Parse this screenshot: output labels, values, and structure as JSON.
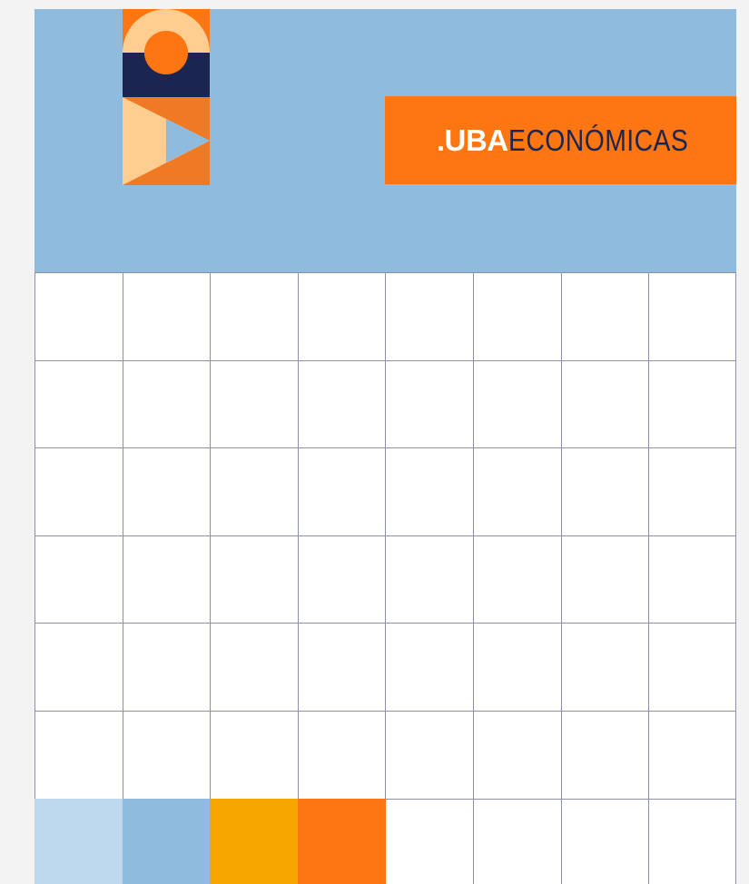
{
  "brand": {
    "strong": ".UBA",
    "light": "ECONÓMICAS"
  },
  "colors": {
    "header_blue": "#8fbcde",
    "orange": "#fd7612",
    "peach": "#fecd8f",
    "navy": "#1b2552",
    "light_blue": "#bed9ee",
    "amber": "#f7a600",
    "grid_line": "#8c90aa"
  },
  "swatches": [
    {
      "name": "swatch-light-blue",
      "color": "#bed9ee"
    },
    {
      "name": "swatch-blue",
      "color": "#8fbcde"
    },
    {
      "name": "swatch-amber",
      "color": "#f7a600"
    },
    {
      "name": "swatch-orange",
      "color": "#fd7612"
    }
  ]
}
